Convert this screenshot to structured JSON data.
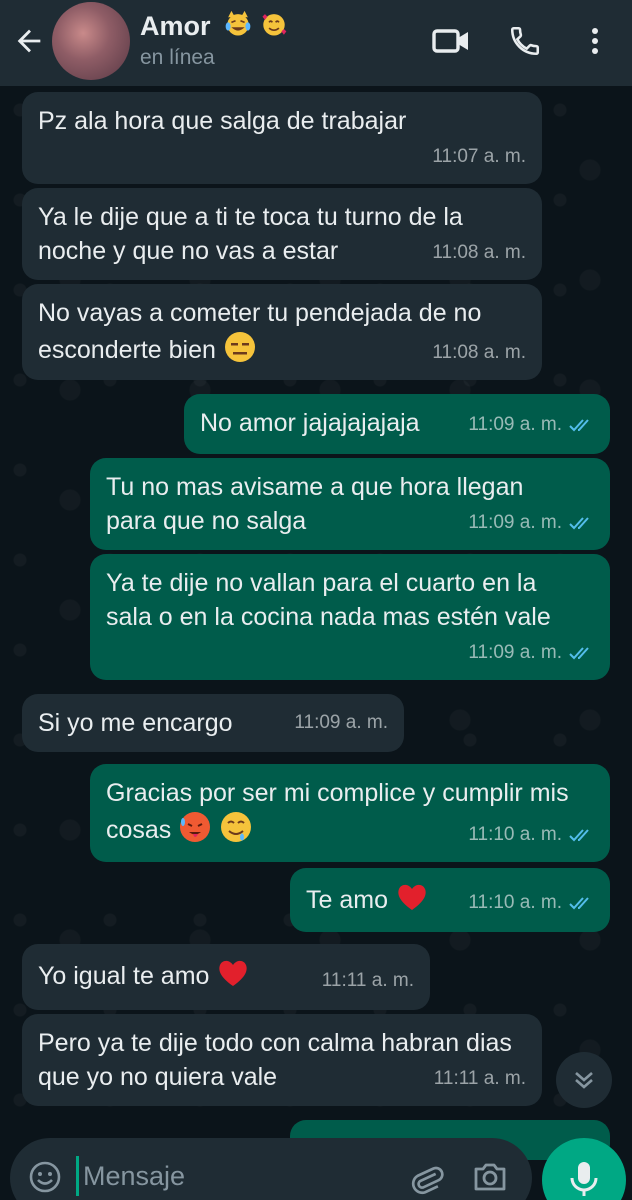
{
  "header": {
    "contact_name": "Amor",
    "contact_status": "en línea",
    "name_emojis": [
      "joy-cat-emoji",
      "smiling-face-with-hearts-emoji"
    ]
  },
  "messages": [
    {
      "dir": "in",
      "text": "Pz ala hora que salga de trabajar",
      "time": "11:07 a. m."
    },
    {
      "dir": "in",
      "text": "Ya le dije que a ti te toca tu turno de la noche y que no vas a estar",
      "time": "11:08 a. m."
    },
    {
      "dir": "in",
      "text": "No vayas a cometer tu pendejada de no esconderte bien",
      "emoji": "expressionless-face-emoji",
      "time": "11:08 a. m."
    },
    {
      "dir": "out",
      "text": "No amor jajajajajaja",
      "time": "11:09 a. m.",
      "status": "read"
    },
    {
      "dir": "out",
      "text": "Tu no mas avisame a que hora llegan para que no salga",
      "time": "11:09 a. m.",
      "status": "read"
    },
    {
      "dir": "out",
      "text": "Ya te dije no vallan para el cuarto en la sala o en la cocina nada mas estén vale",
      "time": "11:09 a. m.",
      "status": "read"
    },
    {
      "dir": "in",
      "text": "Si yo me encargo",
      "time": "11:09 a. m."
    },
    {
      "dir": "out",
      "text": "Gracias por ser mi complice y cumplir mis cosas",
      "emoji": "hot-face-and-drooling-face-emoji",
      "time": "11:10 a. m.",
      "status": "read"
    },
    {
      "dir": "out",
      "text": "Te amo",
      "emoji": "red-heart-emoji",
      "time": "11:10 a. m.",
      "status": "read"
    },
    {
      "dir": "in",
      "text": "Yo igual te amo",
      "emoji": "red-heart-emoji",
      "time": "11:11 a. m."
    },
    {
      "dir": "in",
      "text": "Pero ya te dije todo con calma habran dias que yo no quiera vale",
      "time": "11:11 a. m."
    }
  ],
  "composer": {
    "placeholder": "Mensaje"
  },
  "colors": {
    "background": "#0b141a",
    "header": "#1f2c34",
    "incoming_bubble": "#1f2c34",
    "outgoing_bubble": "#005c4b",
    "accent": "#00a884",
    "read_ticks": "#53bdeb"
  }
}
